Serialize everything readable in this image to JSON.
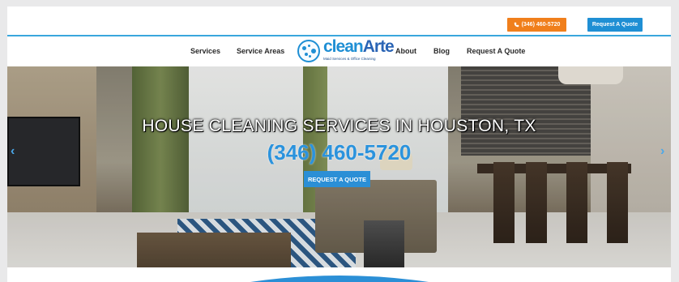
{
  "topbar": {
    "phone_label": "(346) 460-5720",
    "quote_label": "Request A Quote"
  },
  "nav": {
    "items": [
      {
        "label": "Services"
      },
      {
        "label": "Service Areas"
      },
      {
        "label": "About"
      },
      {
        "label": "Blog"
      },
      {
        "label": "Request A Quote"
      }
    ]
  },
  "logo": {
    "clean": "clean",
    "arte": "Arte",
    "tagline": "Maid Services & Office Cleaning"
  },
  "hero": {
    "title": "HOUSE CLEANING SERVICES IN HOUSTON, TX",
    "phone": "(346) 460-5720",
    "button_label": "REQUEST A QUOTE",
    "prev_arrow": "‹",
    "next_arrow": "›"
  },
  "colors": {
    "accent_orange": "#f07f1c",
    "accent_blue": "#1f8fd4",
    "hero_phone_blue": "#2b93dd"
  }
}
